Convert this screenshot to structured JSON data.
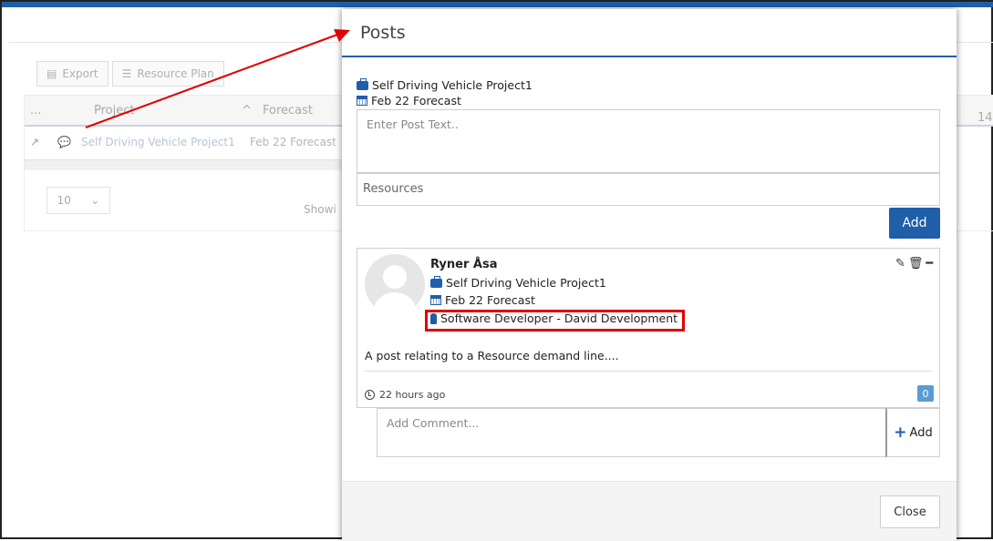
{
  "background": {
    "toolbar": {
      "export_label": "Export",
      "resource_plan_label": "Resource Plan"
    },
    "grid": {
      "headers": [
        "...",
        "Project",
        "Forecast"
      ],
      "row": {
        "project": "Self Driving Vehicle Project1",
        "forecast": "Feb 22 Forecast"
      },
      "pager_size": "10",
      "showing": "Showi",
      "column_number": "14"
    }
  },
  "modal": {
    "title": "Posts",
    "context": {
      "project": "Self Driving Vehicle Project1",
      "forecast": "Feb 22 Forecast"
    },
    "post_input": {
      "placeholder": "Enter Post Text.."
    },
    "resources_input": {
      "placeholder": "Resources"
    },
    "add_label": "Add",
    "post": {
      "author": "Ryner Åsa",
      "project": "Self Driving Vehicle Project1",
      "forecast": "Feb 22 Forecast",
      "resource": "Software Developer - David Development",
      "body": "A post relating to a Resource demand line....",
      "time": "22 hours ago",
      "comment_count": "0"
    },
    "comment_input": {
      "placeholder": "Add Comment..."
    },
    "comment_add_label": "Add",
    "close_label": "Close"
  },
  "colors": {
    "accent": "#1f5ea8",
    "highlight": "#e00000",
    "badge": "#5b9bd5"
  }
}
